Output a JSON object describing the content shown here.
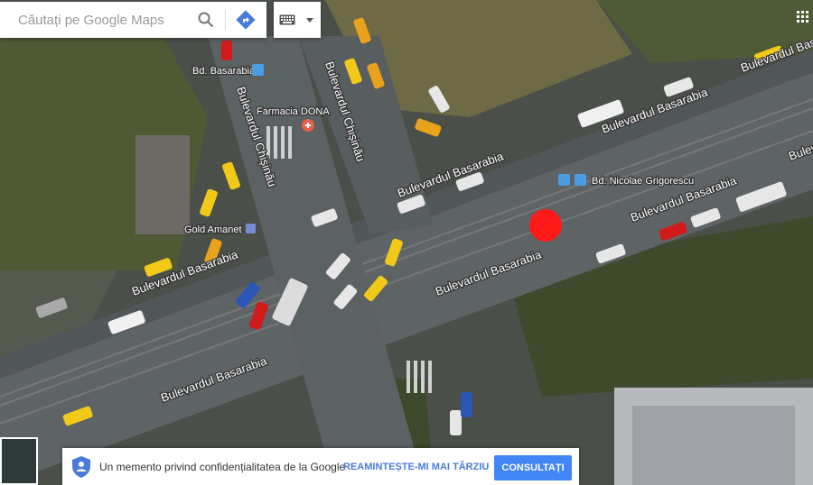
{
  "search": {
    "placeholder": "Căutați pe Google Maps"
  },
  "icons": {
    "search": "search-icon",
    "directions": "directions-icon",
    "keyboard": "keyboard-icon",
    "dropdown": "chevron-down-icon",
    "apps": "apps-grid-icon",
    "shield": "shield-icon"
  },
  "map": {
    "streets": [
      "Bulevardul Basarabia",
      "Bulevardul Chișinău",
      "Bulevardul Chișinău",
      "Bulevardul Basarabia",
      "Bulevardul Basarabia",
      "Bulevardul Basarabia",
      "Bulevardul Basarabia",
      "Bulevardul Basarabia",
      "Bulevardul Basarabia",
      "Bulevar"
    ],
    "pois": {
      "bd_basarabia": "Bd. Basarabia",
      "farmacia": "Farmacia DONA",
      "gold_amanet": "Gold Amanet",
      "nicolae": "Bd. Nicolae Grigorescu"
    },
    "marker_color": "#ff1a1a"
  },
  "privacy": {
    "text": "Un memento privind confidențialitatea de la Google",
    "remind_label": "REAMINTEȘTE-MI MAI TÂRZIU",
    "consult_label": "CONSULTAȚI"
  },
  "colors": {
    "accent": "#4285f4",
    "link": "#4a7bd8"
  }
}
